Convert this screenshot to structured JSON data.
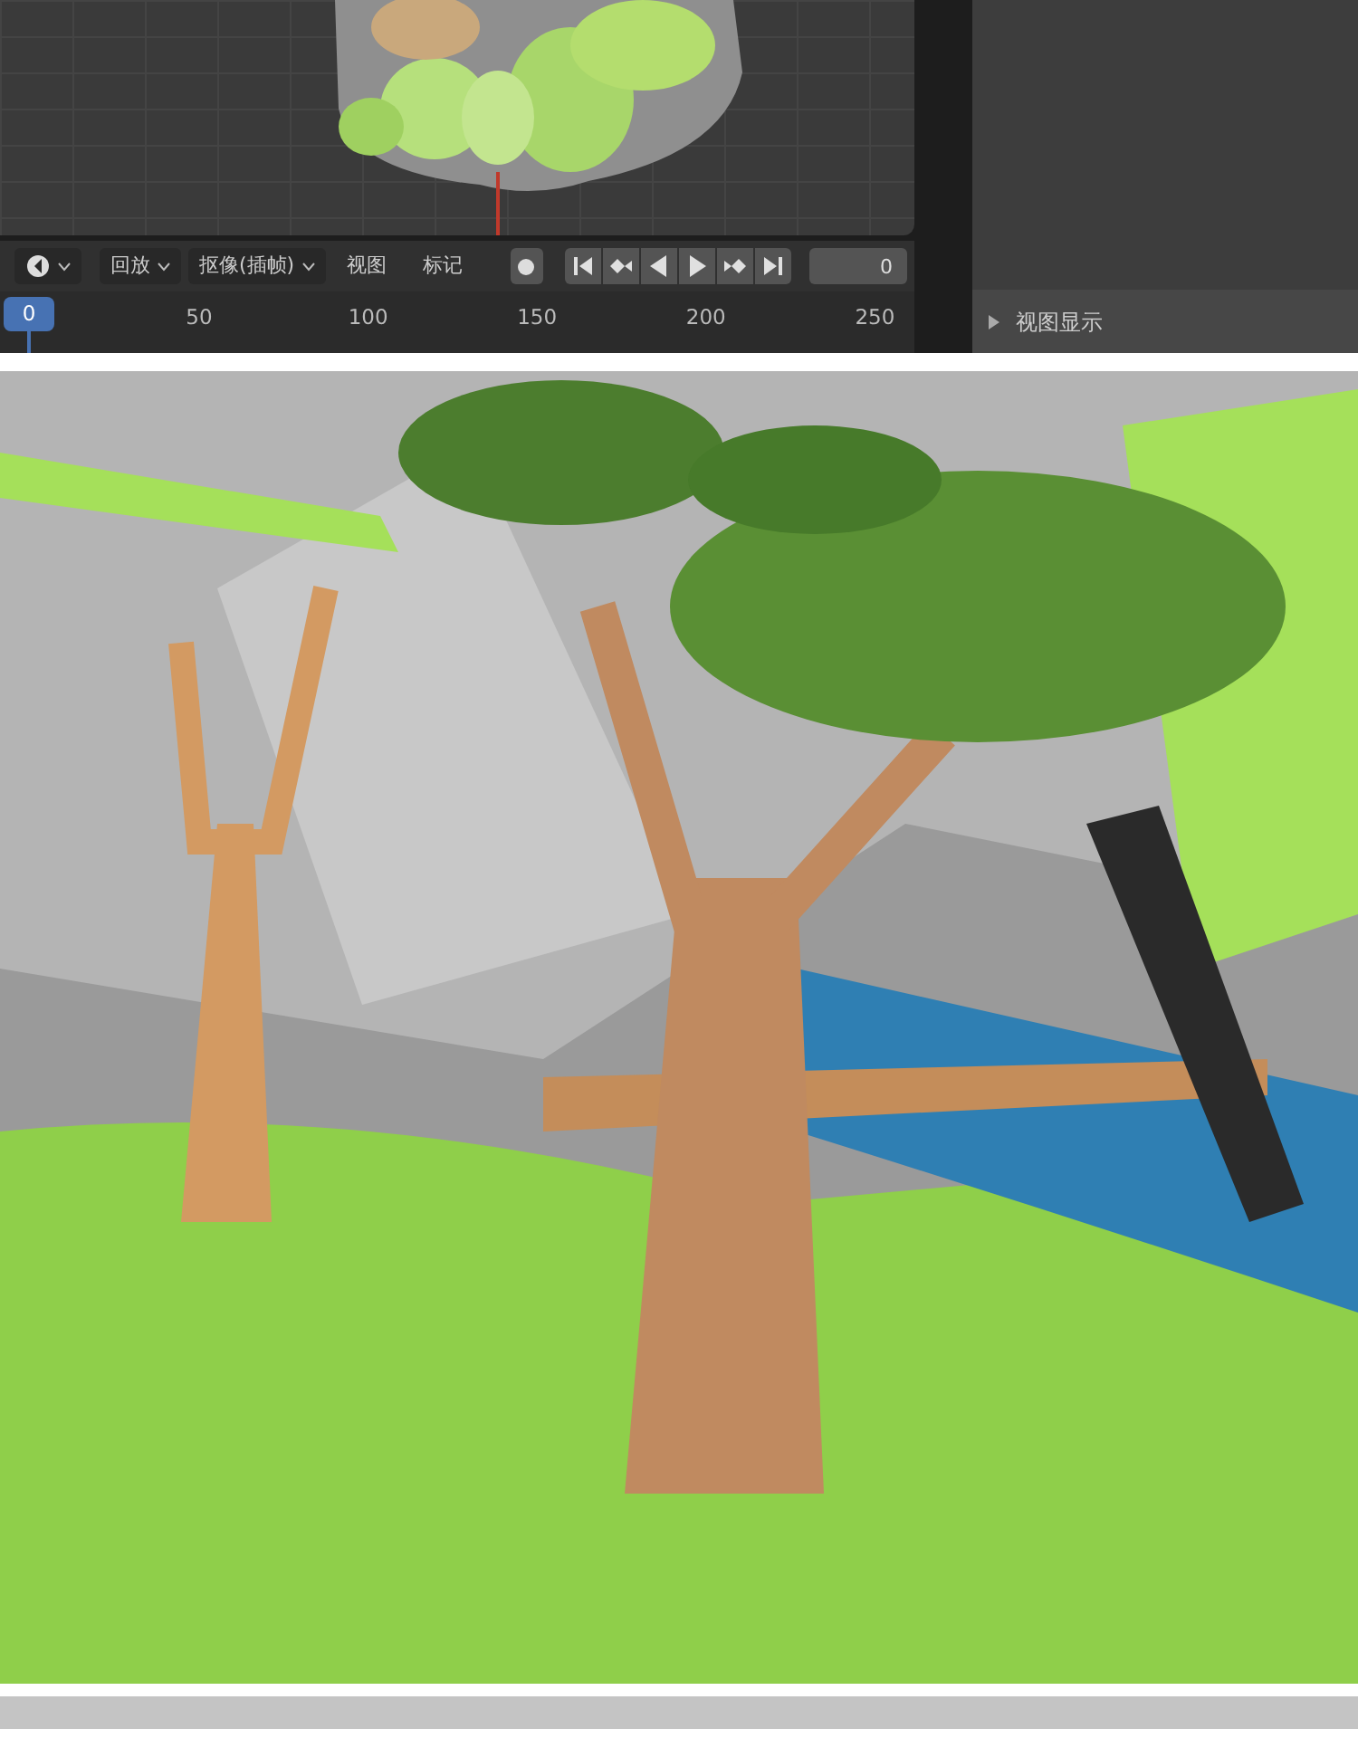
{
  "timeline_header": {
    "menus": [
      {
        "label": "回放",
        "kind": "dropdown"
      },
      {
        "label": "抠像(插帧)",
        "kind": "dropdown"
      },
      {
        "label": "视图",
        "kind": "plain"
      },
      {
        "label": "标记",
        "kind": "plain"
      }
    ],
    "auto_keying": {
      "on": false
    },
    "transport": [
      {
        "kind": "jump-start"
      },
      {
        "kind": "prev-key"
      },
      {
        "kind": "reverse"
      },
      {
        "kind": "play"
      },
      {
        "kind": "next-key"
      },
      {
        "kind": "jump-end"
      }
    ],
    "frame_field": "0"
  },
  "ruler": {
    "current_frame": "0",
    "ticks": [
      "50",
      "100",
      "150",
      "200",
      "250"
    ]
  },
  "properties_panel": {
    "sections": [
      {
        "label": "视图显示",
        "expanded": false
      }
    ]
  }
}
